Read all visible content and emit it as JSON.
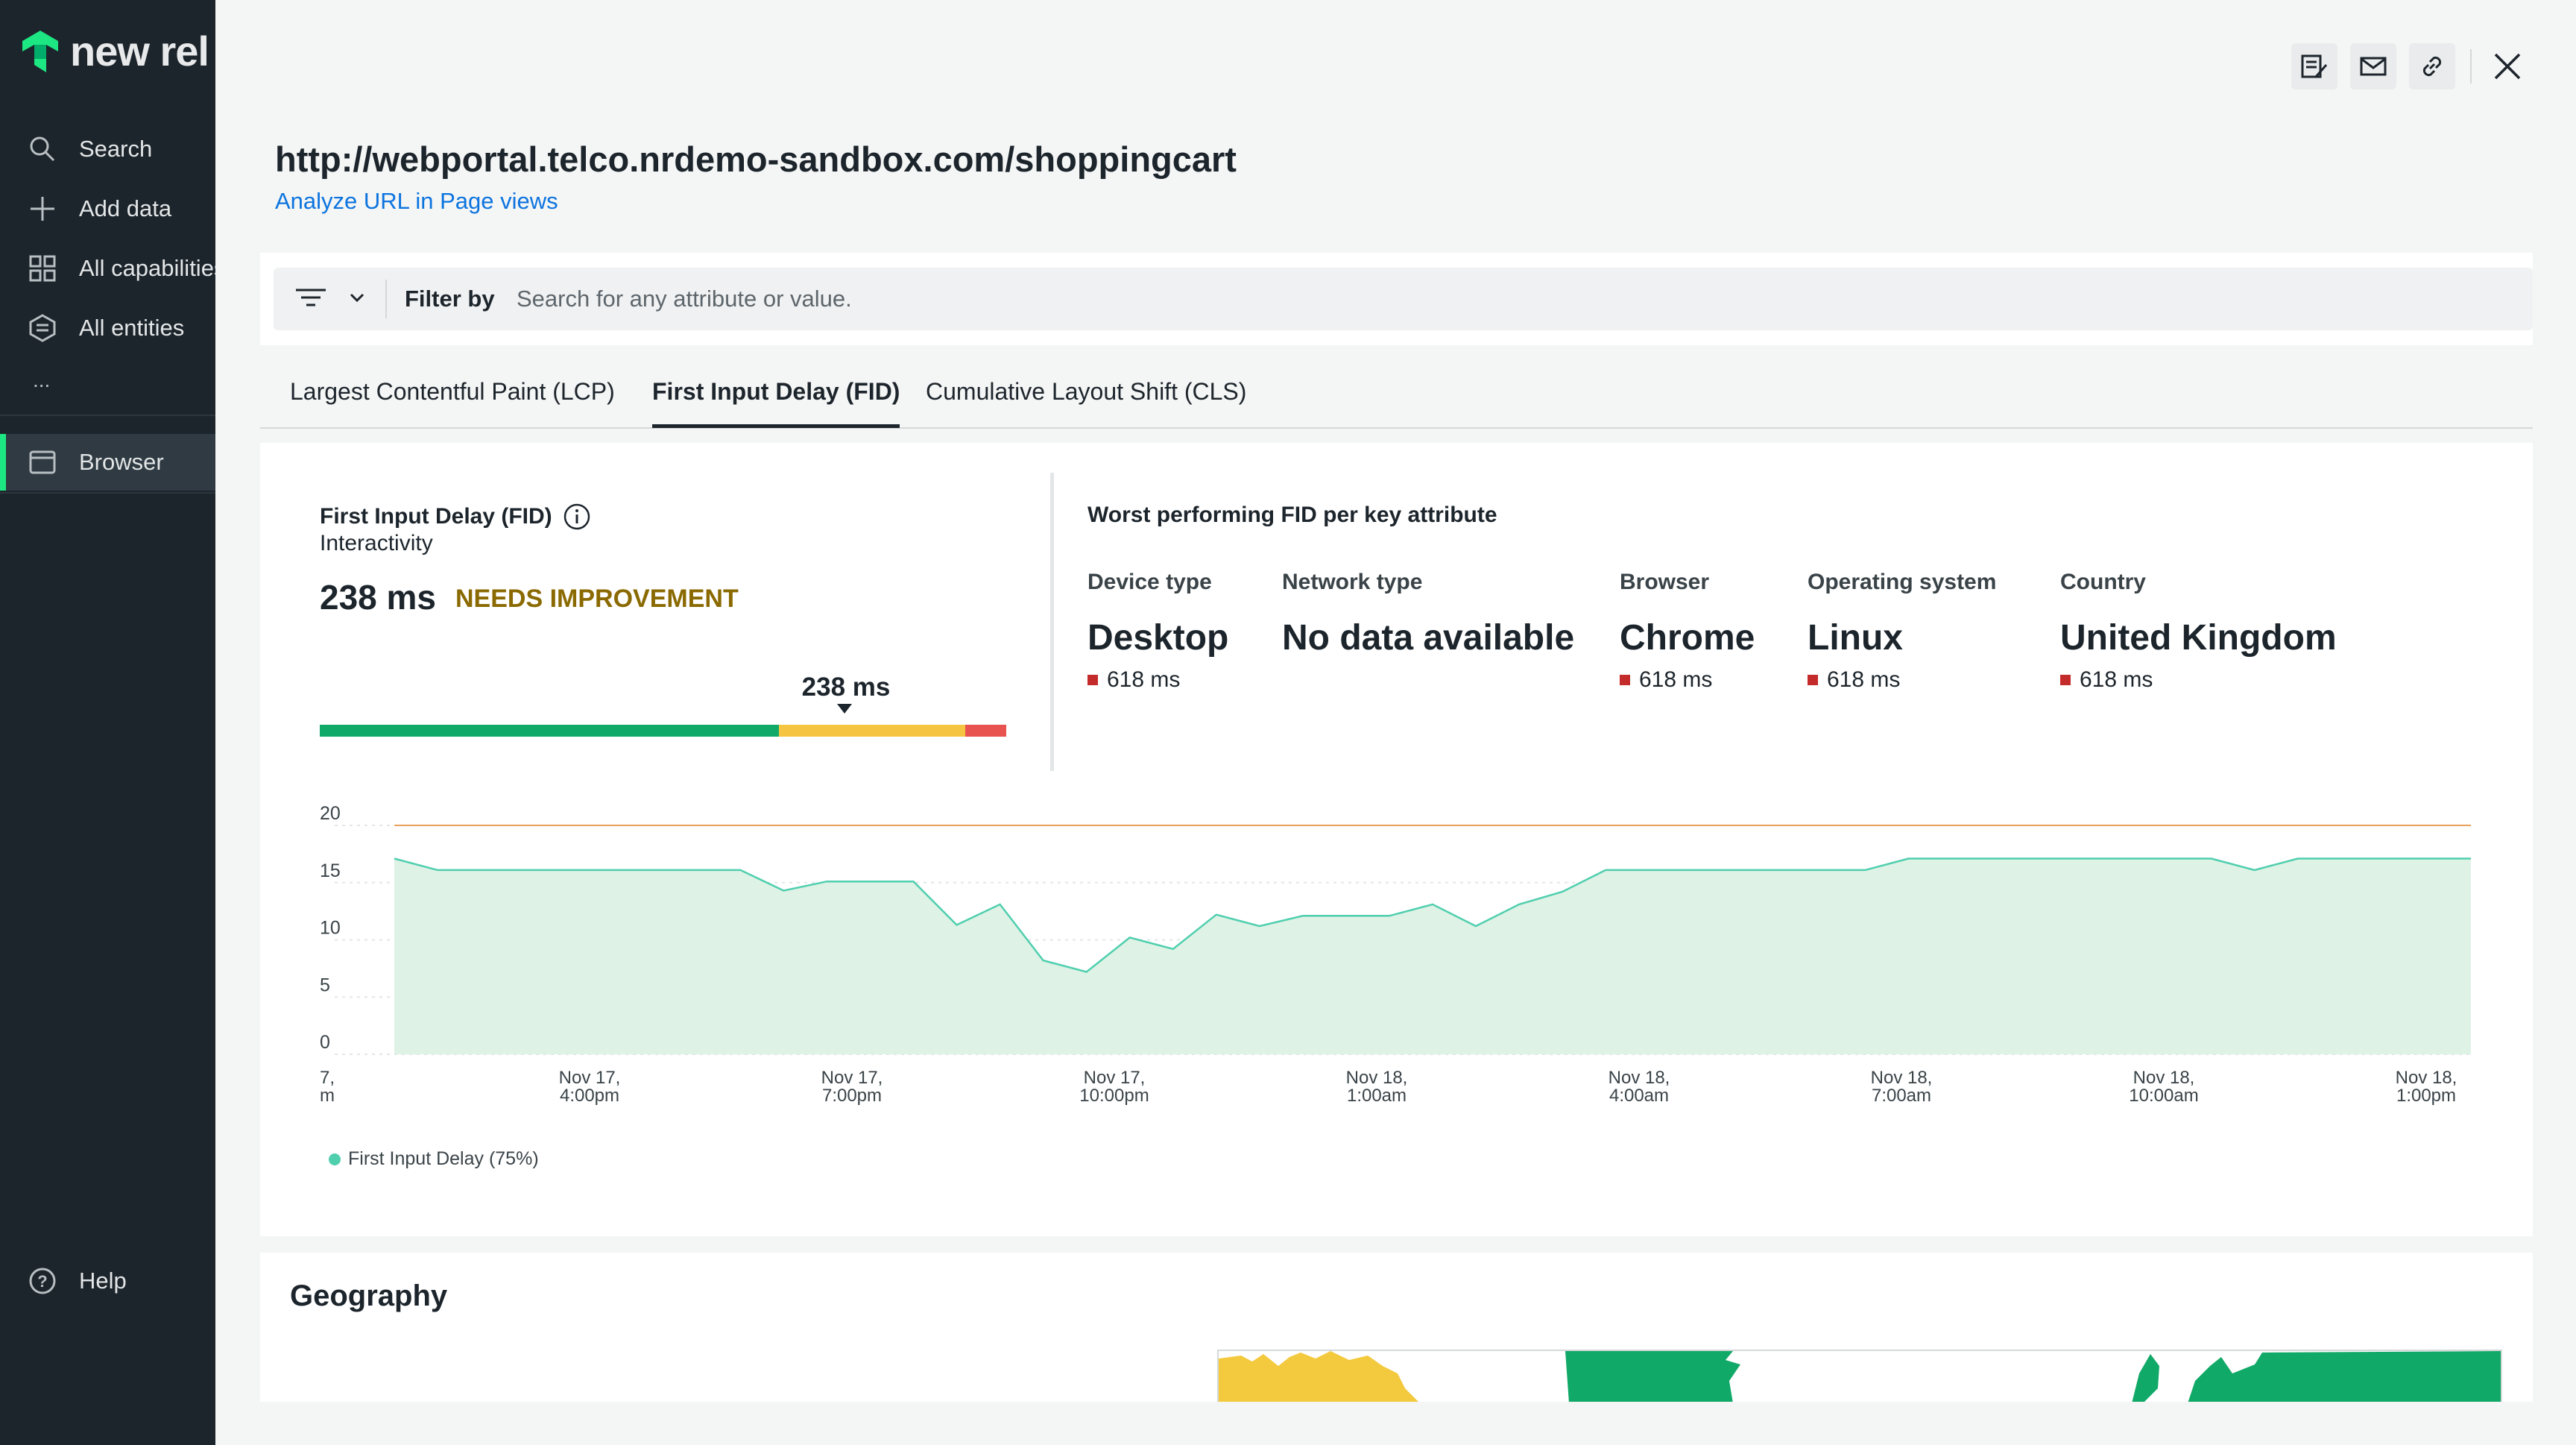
{
  "sidebar": {
    "brand": "new rel",
    "items": [
      {
        "label": "Search",
        "icon": "search-icon"
      },
      {
        "label": "Add data",
        "icon": "plus-icon"
      },
      {
        "label": "All capabilities",
        "icon": "grid-icon"
      },
      {
        "label": "All entities",
        "icon": "entities-icon"
      },
      {
        "label": "...",
        "icon": "more-icon"
      },
      {
        "label": "Browser",
        "icon": "browser-icon"
      }
    ],
    "help": "Help"
  },
  "header": {
    "url_title": "http://webportal.telco.nrdemo-sandbox.com/shoppingcart",
    "analyze_link": "Analyze URL in Page views"
  },
  "filter": {
    "label": "Filter by",
    "placeholder": "Search for any attribute or value."
  },
  "tabs": [
    {
      "label": "Largest Contentful Paint (LCP)",
      "active": false
    },
    {
      "label": "First Input Delay (FID)",
      "active": true
    },
    {
      "label": "Cumulative Layout Shift (CLS)",
      "active": false
    }
  ],
  "metric": {
    "title": "First Input Delay (FID)",
    "subtitle": "Interactivity",
    "value": "238 ms",
    "status": "NEEDS IMPROVEMENT",
    "marker_label": "238 ms",
    "gauge_colors": {
      "good": "#11a968",
      "needs_improvement": "#f5c542",
      "poor": "#e8524f"
    }
  },
  "worst": {
    "title": "Worst performing FID per key attribute",
    "attributes": [
      {
        "name": "Device type",
        "value": "Desktop",
        "ms": "618 ms"
      },
      {
        "name": "Network type",
        "value": "No data available",
        "ms": ""
      },
      {
        "name": "Browser",
        "value": "Chrome",
        "ms": "618 ms"
      },
      {
        "name": "Operating system",
        "value": "Linux",
        "ms": "618 ms"
      },
      {
        "name": "Country",
        "value": "United Kingdom",
        "ms": "618 ms"
      }
    ]
  },
  "chart_data": {
    "type": "area",
    "title": "",
    "xlabel": "",
    "ylabel": "",
    "ylim": [
      0,
      20
    ],
    "y_ticks": [
      "0",
      "5",
      "10",
      "15",
      "20"
    ],
    "x_ticks": [
      [
        "7,",
        "m"
      ],
      [
        "Nov 17,",
        "4:00pm"
      ],
      [
        "Nov 17,",
        "7:00pm"
      ],
      [
        "Nov 17,",
        "10:00pm"
      ],
      [
        "Nov 18,",
        "1:00am"
      ],
      [
        "Nov 18,",
        "4:00am"
      ],
      [
        "Nov 18,",
        "7:00am"
      ],
      [
        "Nov 18,",
        "10:00am"
      ],
      [
        "Nov 18,",
        "1:00pm"
      ]
    ],
    "threshold": 20,
    "series": [
      {
        "name": "First Input Delay (75%)",
        "color": "#4fcfae",
        "values": [
          17.1,
          16.1,
          16.1,
          16.1,
          16.1,
          16.1,
          16.1,
          16.1,
          16.1,
          14.3,
          15.1,
          15.1,
          15.1,
          11.3,
          13.1,
          8.2,
          7.2,
          10.2,
          9.2,
          12.2,
          11.2,
          12.1,
          12.1,
          12.1,
          13.1,
          11.2,
          13.1,
          14.2,
          16.1,
          16.1,
          16.1,
          16.1,
          16.1,
          16.1,
          16.1,
          17.1,
          17.1,
          17.1,
          17.1,
          17.1,
          17.1,
          17.1,
          17.1,
          16.1,
          17.1,
          17.1,
          17.1,
          17.1,
          17.1
        ]
      }
    ]
  },
  "geography": {
    "title": "Geography"
  }
}
